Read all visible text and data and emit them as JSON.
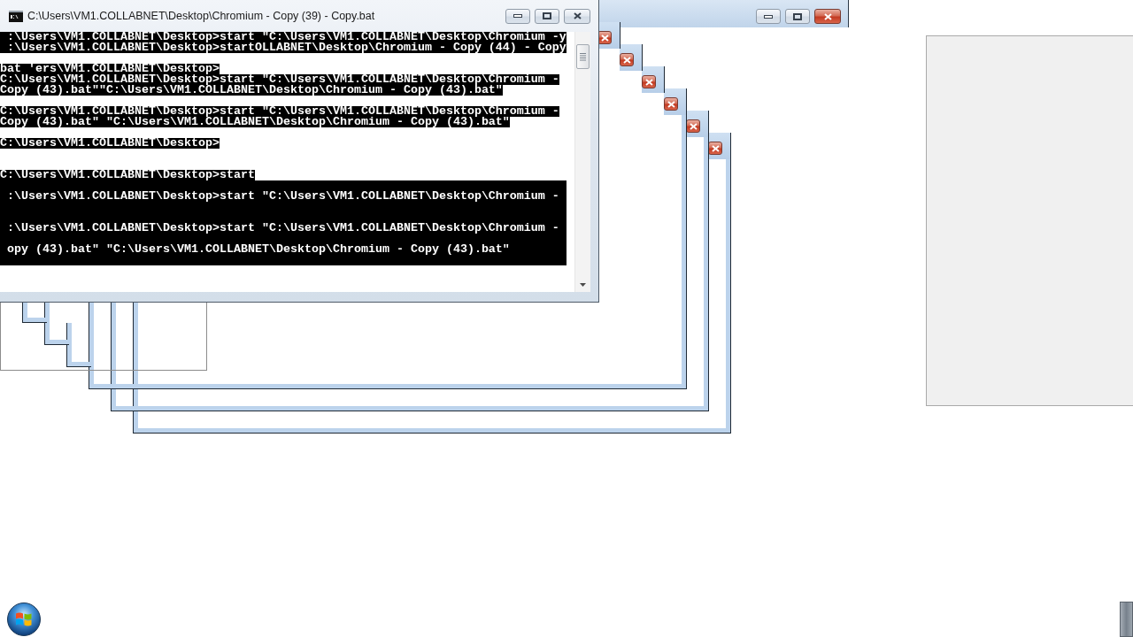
{
  "background_window": {
    "active": true
  },
  "console_window": {
    "title": "C:\\Users\\VM1.COLLABNET\\Desktop\\Chromium - Copy (39) - Copy.bat",
    "active": false,
    "lines": [
      {
        "kind": "text",
        "text": " :\\Users\\VM1.COLLABNET\\Desktop>start \"C:\\Users\\VM1.COLLABNET\\Desktop\\Chromium -y"
      },
      {
        "kind": "text",
        "text": " :\\Users\\VM1.COLLABNET\\Desktop>startOLLABNET\\Desktop\\Chromium - Copy (44) - Copy"
      },
      {
        "kind": "blank"
      },
      {
        "kind": "text",
        "text": "bat 'ers\\VM1.COLLABNET\\Desktop>"
      },
      {
        "kind": "text",
        "text": "C:\\Users\\VM1.COLLABNET\\Desktop>start \"C:\\Users\\VM1.COLLABNET\\Desktop\\Chromium -"
      },
      {
        "kind": "text",
        "text": "Copy (43).bat\"\"C:\\Users\\VM1.COLLABNET\\Desktop\\Chromium - Copy (43).bat\""
      },
      {
        "kind": "blank"
      },
      {
        "kind": "text",
        "text": "C:\\Users\\VM1.COLLABNET\\Desktop>start \"C:\\Users\\VM1.COLLABNET\\Desktop\\Chromium -"
      },
      {
        "kind": "text",
        "text": "Copy (43).bat\" \"C:\\Users\\VM1.COLLABNET\\Desktop\\Chromium - Copy (43).bat\""
      },
      {
        "kind": "blank"
      },
      {
        "kind": "text",
        "text": "C:\\Users\\VM1.COLLABNET\\Desktop>"
      },
      {
        "kind": "blank"
      },
      {
        "kind": "blank"
      },
      {
        "kind": "text",
        "text": "C:\\Users\\VM1.COLLABNET\\Desktop>start"
      }
    ],
    "selection": {
      "lines": [
        {
          "kind": "blank"
        },
        {
          "kind": "text",
          "text": " :\\Users\\VM1.COLLABNET\\Desktop>start \"C:\\Users\\VM1.COLLABNET\\Desktop\\Chromium -"
        },
        {
          "kind": "blank"
        },
        {
          "kind": "blank"
        },
        {
          "kind": "text",
          "text": " :\\Users\\VM1.COLLABNET\\Desktop>start \"C:\\Users\\VM1.COLLABNET\\Desktop\\Chromium -"
        },
        {
          "kind": "blank"
        },
        {
          "kind": "text",
          "text": " opy (43).bat\" \"C:\\Users\\VM1.COLLABNET\\Desktop\\Chromium - Copy (43).bat\""
        },
        {
          "kind": "blank"
        }
      ]
    }
  }
}
